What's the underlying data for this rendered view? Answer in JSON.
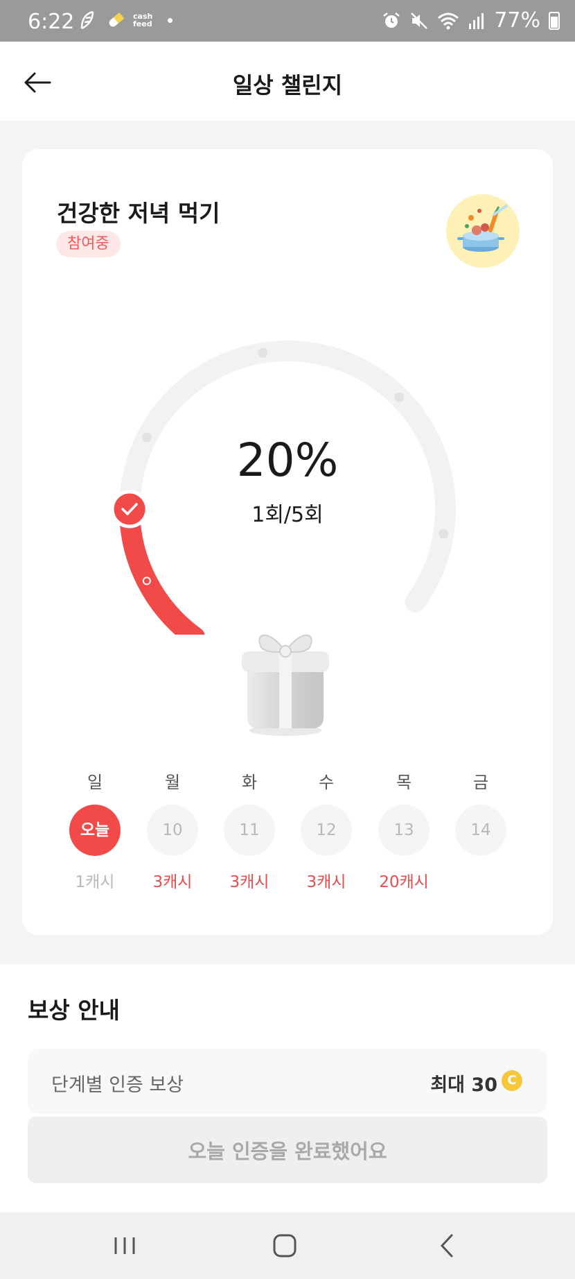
{
  "status_bar": {
    "time": "6:22",
    "app_label_1": "cash",
    "app_label_2": "feed",
    "battery": "77%"
  },
  "header": {
    "title": "일상 챌린지"
  },
  "challenge": {
    "title": "건강한 저녁 먹기",
    "status": "참여중",
    "percent_text": "20%",
    "count_text": "1회/5회",
    "progress": 0.2
  },
  "days": [
    {
      "name": "일",
      "label": "오늘",
      "reward": "1캐시",
      "today": true
    },
    {
      "name": "월",
      "label": "10",
      "reward": "3캐시",
      "today": false
    },
    {
      "name": "화",
      "label": "11",
      "reward": "3캐시",
      "today": false
    },
    {
      "name": "수",
      "label": "12",
      "reward": "3캐시",
      "today": false
    },
    {
      "name": "목",
      "label": "13",
      "reward": "20캐시",
      "today": false
    },
    {
      "name": "금",
      "label": "14",
      "reward": "",
      "today": false
    }
  ],
  "reward_info": {
    "title": "보상 안내",
    "row_label": "단계별 인증 보상",
    "row_value": "최대 30",
    "coin_symbol": "C"
  },
  "complete_button": {
    "label": "오늘 인증을 완료했어요"
  },
  "colors": {
    "accent": "#f24949",
    "chip_bg": "#fde8e8",
    "coin": "#f7c73a"
  }
}
